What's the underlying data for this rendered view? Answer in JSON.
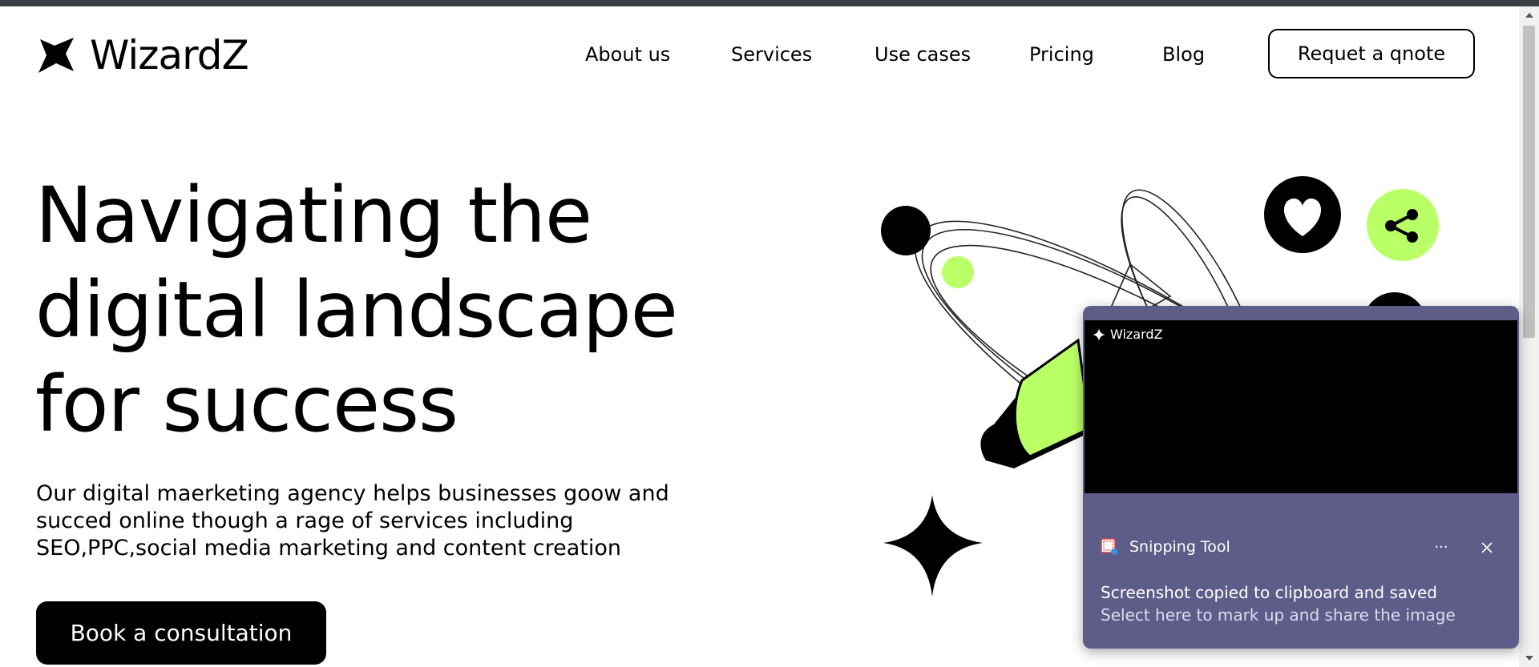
{
  "header": {
    "brand": "WizardZ",
    "nav": [
      "About us",
      "Services",
      "Use cases",
      "Pricing",
      "Blog"
    ],
    "quote_button": "Requet a qnote"
  },
  "hero": {
    "title_lines": [
      "Navigating the",
      "digital landscape",
      "for success"
    ],
    "description_lines": [
      "Our digital maerketing agency helps businesses goow and",
      "succed online though a rage of services including",
      "SEO,PPC,social media marketing and content creation"
    ],
    "cta": "Book a consultation"
  },
  "notification": {
    "preview_brand": "WizardZ",
    "app_name": "Snipping Tool",
    "more_label": "···",
    "title": "Screenshot copied to clipboard and saved",
    "subtitle": "Select here to mark up and share the image"
  },
  "colors": {
    "accent": "#b9ff66",
    "dark": "#000000",
    "toast_bg": "#5e5c88",
    "top_bar": "#3a3d42"
  }
}
